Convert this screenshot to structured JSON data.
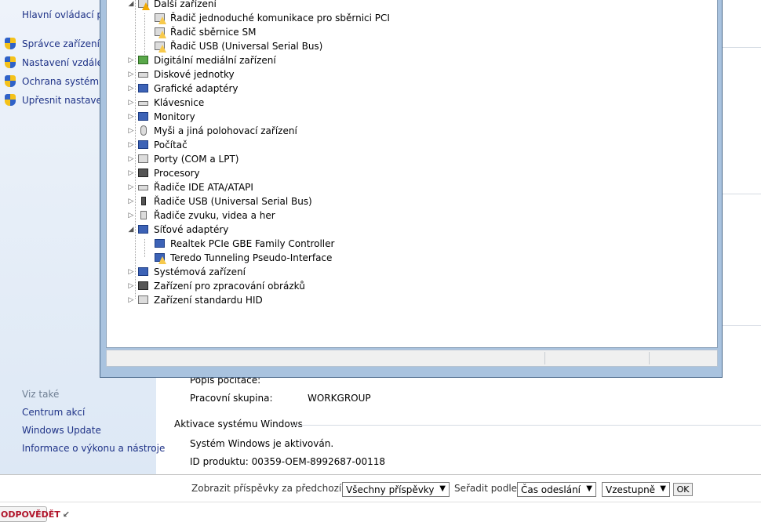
{
  "control_panel": {
    "home_link": "Hlavní ovládací pa",
    "side_links": [
      {
        "label": "Správce zařízení"
      },
      {
        "label": "Nastavení vzdálené"
      },
      {
        "label": "Ochrana systému"
      },
      {
        "label": "Upřesnit nastavení"
      }
    ],
    "see_also_title": "Viz také",
    "see_also_links": [
      {
        "label": "Centrum akcí"
      },
      {
        "label": "Windows Update"
      },
      {
        "label": "Informace o výkonu a nástroje"
      }
    ],
    "computer_description_label": "Popis počítače:",
    "workgroup_label": "Pracovní skupina:",
    "workgroup_value": "WORKGROUP",
    "activation_section": "Aktivace systému Windows",
    "activation_status": "Systém Windows je aktivován.",
    "product_id": "ID produktu: 00359-OEM-8992687-00118"
  },
  "device_manager": {
    "tree": [
      {
        "label": "Další zařízení",
        "expander": "◢",
        "icon": "unknown-device-icon"
      },
      {
        "label": "Řadič jednoduché komunikace pro sběrnici PCI",
        "icon": "warning-device-icon",
        "child": true
      },
      {
        "label": "Řadič sběrnice SM",
        "icon": "warning-device-icon",
        "child": true
      },
      {
        "label": "Řadič USB (Universal Serial Bus)",
        "icon": "warning-device-icon",
        "child": true
      },
      {
        "label": "Digitální mediální zařízení",
        "expander": "▷",
        "icon": "media-device-icon"
      },
      {
        "label": "Diskové jednotky",
        "expander": "▷",
        "icon": "disk-drive-icon"
      },
      {
        "label": "Grafické adaptéry",
        "expander": "▷",
        "icon": "display-adapter-icon"
      },
      {
        "label": "Klávesnice",
        "expander": "▷",
        "icon": "keyboard-icon"
      },
      {
        "label": "Monitory",
        "expander": "▷",
        "icon": "monitor-icon"
      },
      {
        "label": "Myši a jiná polohovací zařízení",
        "expander": "▷",
        "icon": "mouse-icon"
      },
      {
        "label": "Počítač",
        "expander": "▷",
        "icon": "computer-icon"
      },
      {
        "label": "Porty (COM a LPT)",
        "expander": "▷",
        "icon": "port-icon"
      },
      {
        "label": "Procesory",
        "expander": "▷",
        "icon": "processor-icon"
      },
      {
        "label": "Řadiče IDE ATA/ATAPI",
        "expander": "▷",
        "icon": "ide-controller-icon"
      },
      {
        "label": "Řadiče USB (Universal Serial Bus)",
        "expander": "▷",
        "icon": "usb-controller-icon"
      },
      {
        "label": "Řadiče zvuku, videa a her",
        "expander": "▷",
        "icon": "sound-icon"
      },
      {
        "label": "Síťové adaptéry",
        "expander": "◢",
        "icon": "network-adapter-icon"
      },
      {
        "label": "Realtek PCIe GBE Family Controller",
        "icon": "network-adapter-icon",
        "child": true
      },
      {
        "label": "Teredo Tunneling Pseudo-Interface",
        "icon": "network-warning-icon",
        "child": true
      },
      {
        "label": "Systémová zařízení",
        "expander": "▷",
        "icon": "system-device-icon"
      },
      {
        "label": "Zařízení pro zpracování obrázků",
        "expander": "▷",
        "icon": "camera-icon"
      },
      {
        "label": "Zařízení standardu HID",
        "expander": "▷",
        "icon": "hid-icon"
      }
    ]
  },
  "forum_bar": {
    "show_posts_label": "Zobrazit příspěvky za předchozí:",
    "show_posts_value": "Všechny příspěvky",
    "sort_label": "Seřadit podle",
    "sort_value": "Čas odeslání",
    "order_value": "Vzestupně",
    "ok_label": "OK",
    "reply_label": "ODPOVĚDĚT"
  },
  "colors": {
    "link": "#1e3287",
    "window_frame": "#a9c3df",
    "reply_text": "#b0142a"
  }
}
